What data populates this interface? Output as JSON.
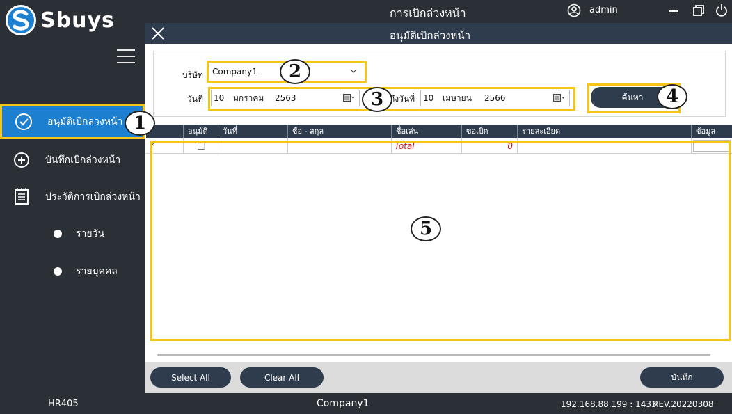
{
  "app": {
    "logo_text": "Sbuys",
    "title": "การเบิกล่วงหน้า",
    "user": "admin"
  },
  "sidebar": {
    "items": [
      {
        "label": "อนุมัติเบิกล่วงหน้า",
        "icon": "check-circle-icon",
        "active": true
      },
      {
        "label": "บันทึกเบิกล่วงหน้า",
        "icon": "plus-circle-icon"
      },
      {
        "label": "ประวัติการเบิกล่วงหน้า",
        "icon": "document-list-icon"
      }
    ],
    "sub_items": [
      {
        "label": "รายวัน"
      },
      {
        "label": "รายบุคคล"
      }
    ]
  },
  "dialog": {
    "title": "อนุมัติเบิกล่วงหน้า"
  },
  "filters": {
    "company_label": "บริษัท",
    "company_value": "Company1",
    "date_from_label": "วันที่",
    "date_from": {
      "day": "10",
      "month": "มกราคม",
      "year": "2563"
    },
    "date_to_label": "ถึงวันที่",
    "date_to": {
      "day": "10",
      "month": "เมษายน",
      "year": "2566"
    },
    "search_label": "ค้นหา"
  },
  "grid": {
    "columns": [
      "",
      "อนุมัติ",
      "วันที่",
      "ชื่อ - สกุล",
      "ชื่อเล่น",
      "ขอเบิก",
      "รายละเอียด",
      "ข้อมูล"
    ],
    "rows": [
      {
        "marker": "*",
        "approved": false,
        "date": "",
        "name": "",
        "nickname": "Total",
        "amount": "0",
        "detail": "",
        "info": ""
      }
    ]
  },
  "actions": {
    "select_all": "Select All",
    "clear_all": "Clear All",
    "save": "บันทึก"
  },
  "status_bar": {
    "module": "HR405",
    "company": "Company1",
    "server": "192.168.88.199 : 1433",
    "revision": "REV.20220308"
  },
  "annotations": [
    "1",
    "2",
    "3",
    "4",
    "5"
  ],
  "colors": {
    "sidebar_bg": "#2b2f36",
    "accent_blue": "#1d7fd0",
    "header_navy": "#2f3c4d",
    "highlight_yellow": "#f5c518",
    "total_red": "#d01010"
  }
}
